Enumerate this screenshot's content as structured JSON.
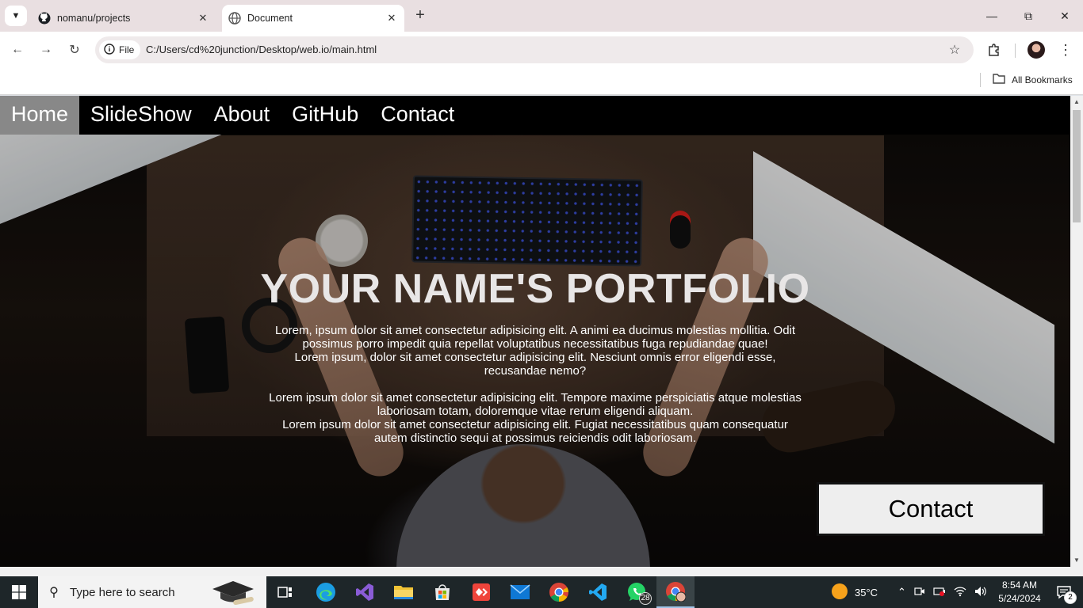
{
  "browser": {
    "tabs": [
      {
        "title": "nomanu/projects",
        "icon": "github-icon",
        "active": false
      },
      {
        "title": "Document",
        "icon": "globe-icon",
        "active": true
      }
    ],
    "omnibox": {
      "chip_label": "File",
      "url": "C:/Users/cd%20junction/Desktop/web.io/main.html"
    },
    "bookmarks": {
      "all_label": "All Bookmarks"
    }
  },
  "site": {
    "nav": [
      "Home",
      "SlideShow",
      "About",
      "GitHub",
      "Contact"
    ],
    "active_nav": "Home",
    "headline": "YOUR NAME'S PORTFOLIO",
    "paragraph1_line1": "Lorem, ipsum dolor sit amet consectetur adipisicing elit. A animi ea ducimus molestias mollitia. Odit possimus porro impedit quia repellat voluptatibus necessitatibus fuga repudiandae quae!",
    "paragraph1_line2": "Lorem ipsum, dolor sit amet consectetur adipisicing elit. Nesciunt omnis error eligendi esse, recusandae nemo?",
    "paragraph2_line1": "Lorem ipsum dolor sit amet consectetur adipisicing elit. Tempore maxime perspiciatis atque molestias laboriosam totam, doloremque vitae rerum eligendi aliquam.",
    "paragraph2_line2": "Lorem ipsum dolor sit amet consectetur adipisicing elit. Fugiat necessitatibus quam consequatur autem distinctio sequi at possimus reiciendis odit laboriosam.",
    "contact_button": "Contact"
  },
  "taskbar": {
    "search_placeholder": "Type here to search",
    "whatsapp_badge": "28",
    "weather": "35°C",
    "time": "8:54 AM",
    "date": "5/24/2024",
    "notifications": "2",
    "colors": {
      "bar": "#1e2629",
      "accent": "#9ec3e6"
    }
  }
}
